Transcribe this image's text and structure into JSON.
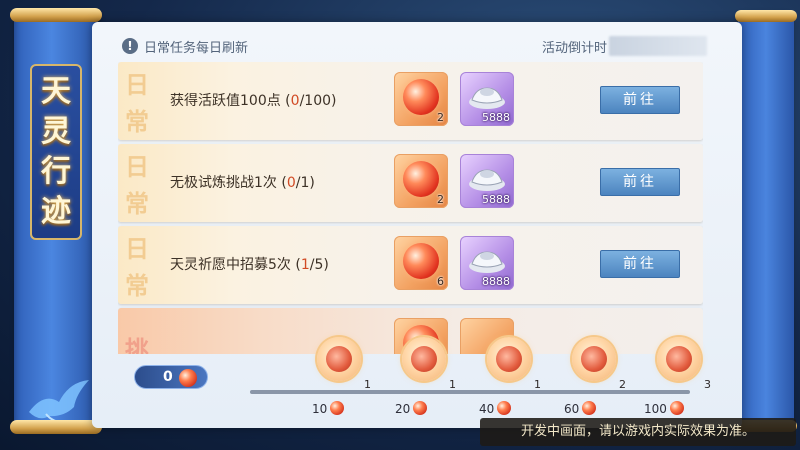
{
  "title_chars": [
    "天",
    "灵",
    "行",
    "迹"
  ],
  "header": {
    "notice": "日常任务每日刷新",
    "countdown_label": "活动倒计时"
  },
  "tasks": [
    {
      "tag": [
        "日",
        "常"
      ],
      "text": "获得活跃值100点",
      "current": "0",
      "total": "/100",
      "reward1_count": "2",
      "reward2_count": "5888",
      "button": "前往"
    },
    {
      "tag": [
        "日",
        "常"
      ],
      "text": "无极试炼挑战1次",
      "current": "0",
      "total": "/1",
      "reward1_count": "2",
      "reward2_count": "5888",
      "button": "前往"
    },
    {
      "tag": [
        "日",
        "常"
      ],
      "text": "天灵祈愿中招募5次",
      "current": "1",
      "total": "/5",
      "reward1_count": "6",
      "reward2_count": "8888",
      "button": "前往"
    },
    {
      "tag": [
        "挑"
      ],
      "text": "",
      "current": "",
      "total": "",
      "reward1_count": "",
      "reward2_count": "",
      "button": ""
    }
  ],
  "progress": {
    "current_value": "0",
    "milestones": [
      {
        "threshold": "10",
        "count": "1"
      },
      {
        "threshold": "20",
        "count": "1"
      },
      {
        "threshold": "40",
        "count": "1"
      },
      {
        "threshold": "60",
        "count": "2"
      },
      {
        "threshold": "100",
        "count": "3"
      }
    ]
  },
  "disclaimer": "开发中画面，请以游戏内实际效果为准。",
  "colors": {
    "accent_blue": "#4c84bf",
    "progress_red": "#d14a24",
    "gold": "#d7b66a"
  }
}
